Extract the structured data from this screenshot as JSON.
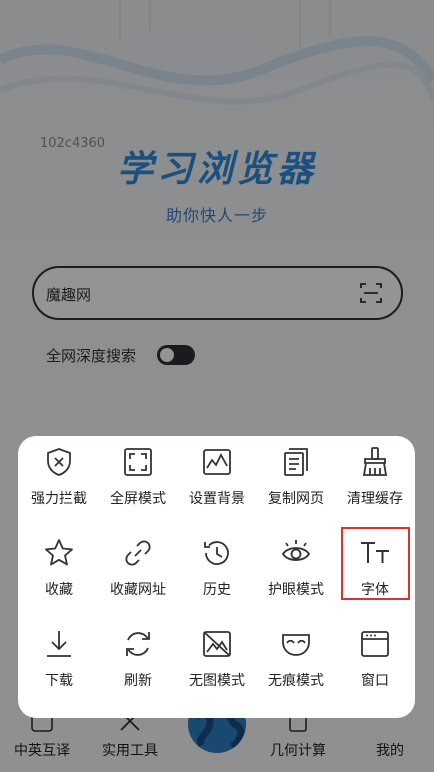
{
  "build_id": "102c4360",
  "brand": {
    "title": "学习浏览器",
    "subtitle": "助你快人一步"
  },
  "search": {
    "value": "魔趣网",
    "scan_icon": "scan-icon"
  },
  "deep_search": {
    "label": "全网深度搜索",
    "enabled": true
  },
  "bottom_nav": [
    {
      "label": "中英互译",
      "icon": "translate-icon"
    },
    {
      "label": "实用工具",
      "icon": "tools-icon"
    },
    {
      "label": "",
      "icon": "globe-icon"
    },
    {
      "label": "几何计算",
      "icon": "calculator-icon"
    },
    {
      "label": "我的",
      "icon": "profile-icon"
    }
  ],
  "menu": {
    "rows": [
      [
        {
          "label": "强力拦截",
          "icon": "shield-block-icon"
        },
        {
          "label": "全屏模式",
          "icon": "fullscreen-icon"
        },
        {
          "label": "设置背景",
          "icon": "background-image-icon"
        },
        {
          "label": "复制网页",
          "icon": "copy-page-icon"
        },
        {
          "label": "清理缓存",
          "icon": "brush-clean-icon"
        }
      ],
      [
        {
          "label": "收藏",
          "icon": "star-icon"
        },
        {
          "label": "收藏网址",
          "icon": "link-icon"
        },
        {
          "label": "历史",
          "icon": "history-icon"
        },
        {
          "label": "护眼模式",
          "icon": "eye-icon"
        },
        {
          "label": "字体",
          "icon": "font-size-icon",
          "highlighted": true
        }
      ],
      [
        {
          "label": "下载",
          "icon": "download-icon"
        },
        {
          "label": "刷新",
          "icon": "refresh-icon"
        },
        {
          "label": "无图模式",
          "icon": "no-image-icon"
        },
        {
          "label": "无痕模式",
          "icon": "incognito-mask-icon"
        },
        {
          "label": "窗口",
          "icon": "window-icon"
        }
      ]
    ]
  },
  "colors": {
    "brand_blue": "#2f88d8",
    "highlight_red": "#d9352c",
    "overlay": "rgba(0,0,0,0.42)"
  }
}
